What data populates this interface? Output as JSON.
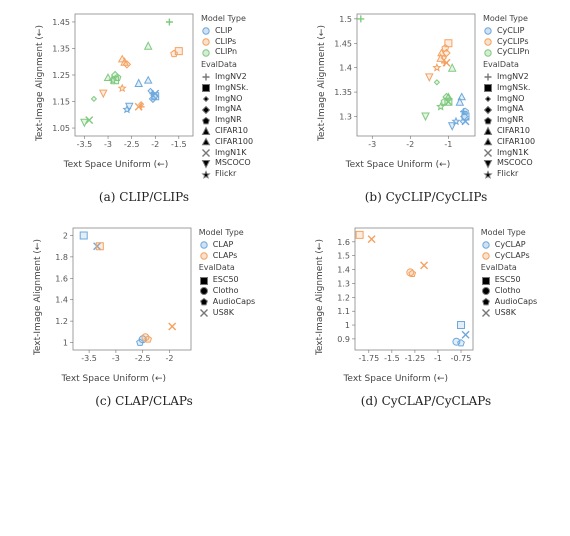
{
  "chart_data": [
    {
      "id": "a",
      "caption": "(a) CLIP/CLIPs",
      "xlabel": "Text Space Uniform (←)",
      "ylabel": "Text-Image Alignment (←)",
      "xlim": [
        -3.7,
        -1.2
      ],
      "ylim": [
        1.02,
        1.48
      ],
      "xticks": [
        -3.5,
        -3.0,
        -2.5,
        -2.0,
        -1.5
      ],
      "yticks": [
        1.05,
        1.15,
        1.25,
        1.35,
        1.45
      ],
      "model_types": [
        {
          "name": "CLIP",
          "color": "#6fa8dc"
        },
        {
          "name": "CLIPs",
          "color": "#f4a261"
        },
        {
          "name": "CLIPn",
          "color": "#7fc97f"
        }
      ],
      "eval_data": [
        "ImgNV2",
        "ImgNSk.",
        "ImgNO",
        "ImgNA",
        "ImgNR",
        "CIFAR10",
        "CIFAR100",
        "ImgN1K",
        "MSCOCO",
        "Flickr"
      ],
      "points": [
        {
          "x": -2.05,
          "y": 1.18,
          "model": "CLIP",
          "dataset": "ImgNV2"
        },
        {
          "x": -2.0,
          "y": 1.17,
          "model": "CLIP",
          "dataset": "ImgNSk."
        },
        {
          "x": -2.1,
          "y": 1.19,
          "model": "CLIP",
          "dataset": "ImgNO"
        },
        {
          "x": -2.05,
          "y": 1.16,
          "model": "CLIP",
          "dataset": "ImgNA"
        },
        {
          "x": -2.02,
          "y": 1.17,
          "model": "CLIP",
          "dataset": "ImgNR"
        },
        {
          "x": -2.35,
          "y": 1.22,
          "model": "CLIP",
          "dataset": "CIFAR10"
        },
        {
          "x": -2.15,
          "y": 1.23,
          "model": "CLIP",
          "dataset": "CIFAR100"
        },
        {
          "x": -2.0,
          "y": 1.18,
          "model": "CLIP",
          "dataset": "ImgN1K"
        },
        {
          "x": -2.55,
          "y": 1.13,
          "model": "CLIP",
          "dataset": "MSCOCO"
        },
        {
          "x": -2.6,
          "y": 1.12,
          "model": "CLIP",
          "dataset": "Flickr"
        },
        {
          "x": -2.3,
          "y": 1.13,
          "model": "CLIPs",
          "dataset": "ImgNV2"
        },
        {
          "x": -1.5,
          "y": 1.34,
          "model": "CLIPs",
          "dataset": "ImgNSk."
        },
        {
          "x": -2.3,
          "y": 1.14,
          "model": "CLIPs",
          "dataset": "ImgNO"
        },
        {
          "x": -2.6,
          "y": 1.29,
          "model": "CLIPs",
          "dataset": "ImgNA"
        },
        {
          "x": -1.6,
          "y": 1.33,
          "model": "CLIPs",
          "dataset": "ImgNR"
        },
        {
          "x": -2.65,
          "y": 1.3,
          "model": "CLIPs",
          "dataset": "CIFAR10"
        },
        {
          "x": -2.7,
          "y": 1.31,
          "model": "CLIPs",
          "dataset": "CIFAR100"
        },
        {
          "x": -2.35,
          "y": 1.13,
          "model": "CLIPs",
          "dataset": "ImgN1K"
        },
        {
          "x": -3.1,
          "y": 1.18,
          "model": "CLIPs",
          "dataset": "MSCOCO"
        },
        {
          "x": -2.7,
          "y": 1.2,
          "model": "CLIPs",
          "dataset": "Flickr"
        },
        {
          "x": -1.7,
          "y": 1.45,
          "model": "CLIPn",
          "dataset": "ImgNV2"
        },
        {
          "x": -2.85,
          "y": 1.23,
          "model": "CLIPn",
          "dataset": "ImgNSk."
        },
        {
          "x": -3.3,
          "y": 1.16,
          "model": "CLIPn",
          "dataset": "ImgNO"
        },
        {
          "x": -2.85,
          "y": 1.25,
          "model": "CLIPn",
          "dataset": "ImgNA"
        },
        {
          "x": -2.8,
          "y": 1.24,
          "model": "CLIPn",
          "dataset": "ImgNR"
        },
        {
          "x": -2.15,
          "y": 1.36,
          "model": "CLIPn",
          "dataset": "CIFAR10"
        },
        {
          "x": -3.0,
          "y": 1.24,
          "model": "CLIPn",
          "dataset": "CIFAR100"
        },
        {
          "x": -3.4,
          "y": 1.08,
          "model": "CLIPn",
          "dataset": "ImgN1K"
        },
        {
          "x": -3.5,
          "y": 1.07,
          "model": "CLIPn",
          "dataset": "MSCOCO"
        },
        {
          "x": -2.9,
          "y": 1.23,
          "model": "CLIPn",
          "dataset": "Flickr"
        }
      ]
    },
    {
      "id": "b",
      "caption": "(b) CyCLIP/CyCLIPs",
      "xlabel": "Text Space Uniform (←)",
      "ylabel": "Text-Image Alignment (←)",
      "xlim": [
        -3.4,
        -0.3
      ],
      "ylim": [
        1.26,
        1.51
      ],
      "xticks": [
        -3,
        -2,
        -1
      ],
      "yticks": [
        1.3,
        1.35,
        1.4,
        1.45,
        1.5
      ],
      "model_types": [
        {
          "name": "CyCLIP",
          "color": "#6fa8dc"
        },
        {
          "name": "CyCLIPs",
          "color": "#f4a261"
        },
        {
          "name": "CyCLIPn",
          "color": "#7fc97f"
        }
      ],
      "eval_data": [
        "ImgNV2",
        "ImgNSk.",
        "ImgNO",
        "ImgNA",
        "ImgNR",
        "CIFAR10",
        "CIFAR100",
        "ImgN1K",
        "MSCOCO",
        "Flickr"
      ],
      "points": [
        {
          "x": -0.6,
          "y": 1.31,
          "model": "CyCLIP",
          "dataset": "ImgNV2"
        },
        {
          "x": -0.55,
          "y": 1.3,
          "model": "CyCLIP",
          "dataset": "ImgNSk."
        },
        {
          "x": -0.62,
          "y": 1.29,
          "model": "CyCLIP",
          "dataset": "ImgNO"
        },
        {
          "x": -0.58,
          "y": 1.3,
          "model": "CyCLIP",
          "dataset": "ImgNA"
        },
        {
          "x": -0.56,
          "y": 1.31,
          "model": "CyCLIP",
          "dataset": "ImgNR"
        },
        {
          "x": -0.7,
          "y": 1.33,
          "model": "CyCLIP",
          "dataset": "CIFAR10"
        },
        {
          "x": -0.65,
          "y": 1.34,
          "model": "CyCLIP",
          "dataset": "CIFAR100"
        },
        {
          "x": -0.55,
          "y": 1.29,
          "model": "CyCLIP",
          "dataset": "ImgN1K"
        },
        {
          "x": -0.9,
          "y": 1.28,
          "model": "CyCLIP",
          "dataset": "MSCOCO"
        },
        {
          "x": -0.8,
          "y": 1.29,
          "model": "CyCLIP",
          "dataset": "Flickr"
        },
        {
          "x": -1.1,
          "y": 1.41,
          "model": "CyCLIPs",
          "dataset": "ImgNV2"
        },
        {
          "x": -1.0,
          "y": 1.45,
          "model": "CyCLIPs",
          "dataset": "ImgNSk."
        },
        {
          "x": -1.12,
          "y": 1.42,
          "model": "CyCLIPs",
          "dataset": "ImgNO"
        },
        {
          "x": -1.05,
          "y": 1.43,
          "model": "CyCLIPs",
          "dataset": "ImgNA"
        },
        {
          "x": -1.08,
          "y": 1.44,
          "model": "CyCLIPs",
          "dataset": "ImgNR"
        },
        {
          "x": -1.2,
          "y": 1.42,
          "model": "CyCLIPs",
          "dataset": "CIFAR10"
        },
        {
          "x": -1.18,
          "y": 1.43,
          "model": "CyCLIPs",
          "dataset": "CIFAR100"
        },
        {
          "x": -1.05,
          "y": 1.41,
          "model": "CyCLIPs",
          "dataset": "ImgN1K"
        },
        {
          "x": -1.5,
          "y": 1.38,
          "model": "CyCLIPs",
          "dataset": "MSCOCO"
        },
        {
          "x": -1.3,
          "y": 1.4,
          "model": "CyCLIPs",
          "dataset": "Flickr"
        },
        {
          "x": -3.3,
          "y": 1.5,
          "model": "CyCLIPn",
          "dataset": "ImgNV2"
        },
        {
          "x": -1.0,
          "y": 1.33,
          "model": "CyCLIPn",
          "dataset": "ImgNSk."
        },
        {
          "x": -1.3,
          "y": 1.37,
          "model": "CyCLIPn",
          "dataset": "ImgNO"
        },
        {
          "x": -1.05,
          "y": 1.34,
          "model": "CyCLIPn",
          "dataset": "ImgNA"
        },
        {
          "x": -1.1,
          "y": 1.33,
          "model": "CyCLIPn",
          "dataset": "ImgNR"
        },
        {
          "x": -0.9,
          "y": 1.4,
          "model": "CyCLIPn",
          "dataset": "CIFAR10"
        },
        {
          "x": -1.0,
          "y": 1.34,
          "model": "CyCLIPn",
          "dataset": "CIFAR100"
        },
        {
          "x": -1.0,
          "y": 1.33,
          "model": "CyCLIPn",
          "dataset": "ImgN1K"
        },
        {
          "x": -1.6,
          "y": 1.3,
          "model": "CyCLIPn",
          "dataset": "MSCOCO"
        },
        {
          "x": -1.2,
          "y": 1.32,
          "model": "CyCLIPn",
          "dataset": "Flickr"
        }
      ]
    },
    {
      "id": "c",
      "caption": "(c) CLAP/CLAPs",
      "xlabel": "Text Space Uniform (←)",
      "ylabel": "Text-Image Alignment (←)",
      "xlim": [
        -3.8,
        -1.6
      ],
      "ylim": [
        0.93,
        2.07
      ],
      "xticks": [
        -3.5,
        -3.0,
        -2.5,
        -2.0
      ],
      "yticks": [
        1.0,
        1.2,
        1.4,
        1.6,
        1.8,
        2.0
      ],
      "model_types": [
        {
          "name": "CLAP",
          "color": "#6fa8dc"
        },
        {
          "name": "CLAPs",
          "color": "#f4a261"
        }
      ],
      "eval_data": [
        "ESC50",
        "Clotho",
        "AudioCaps",
        "US8K"
      ],
      "points": [
        {
          "x": -3.6,
          "y": 2.0,
          "model": "CLAP",
          "dataset": "ESC50"
        },
        {
          "x": -2.5,
          "y": 1.03,
          "model": "CLAP",
          "dataset": "Clotho"
        },
        {
          "x": -2.55,
          "y": 1.0,
          "model": "CLAP",
          "dataset": "AudioCaps"
        },
        {
          "x": -3.35,
          "y": 1.9,
          "model": "CLAP",
          "dataset": "US8K"
        },
        {
          "x": -3.3,
          "y": 1.9,
          "model": "CLAPs",
          "dataset": "ESC50"
        },
        {
          "x": -2.45,
          "y": 1.05,
          "model": "CLAPs",
          "dataset": "Clotho"
        },
        {
          "x": -2.4,
          "y": 1.03,
          "model": "CLAPs",
          "dataset": "AudioCaps"
        },
        {
          "x": -1.95,
          "y": 1.15,
          "model": "CLAPs",
          "dataset": "US8K"
        }
      ]
    },
    {
      "id": "d",
      "caption": "(d) CyCLAP/CyCLAPs",
      "xlabel": "Text Space Uniform (←)",
      "ylabel": "Text-Image Alignment (←)",
      "xlim": [
        -1.9,
        -0.62
      ],
      "ylim": [
        0.82,
        1.7
      ],
      "xticks": [
        -1.75,
        -1.5,
        -1.25,
        -1.0,
        -0.75
      ],
      "yticks": [
        0.9,
        1.0,
        1.1,
        1.2,
        1.3,
        1.4,
        1.5,
        1.6
      ],
      "model_types": [
        {
          "name": "CyCLAP",
          "color": "#6fa8dc"
        },
        {
          "name": "CyCLAPs",
          "color": "#f4a261"
        }
      ],
      "eval_data": [
        "ESC50",
        "Clotho",
        "AudioCaps",
        "US8K"
      ],
      "points": [
        {
          "x": -0.75,
          "y": 1.0,
          "model": "CyCLAP",
          "dataset": "ESC50"
        },
        {
          "x": -0.8,
          "y": 0.88,
          "model": "CyCLAP",
          "dataset": "Clotho"
        },
        {
          "x": -0.75,
          "y": 0.87,
          "model": "CyCLAP",
          "dataset": "AudioCaps"
        },
        {
          "x": -0.7,
          "y": 0.93,
          "model": "CyCLAP",
          "dataset": "US8K"
        },
        {
          "x": -1.85,
          "y": 1.65,
          "model": "CyCLAPs",
          "dataset": "ESC50"
        },
        {
          "x": -1.3,
          "y": 1.38,
          "model": "CyCLAPs",
          "dataset": "Clotho"
        },
        {
          "x": -1.28,
          "y": 1.37,
          "model": "CyCLAPs",
          "dataset": "AudioCaps"
        },
        {
          "x": -1.72,
          "y": 1.62,
          "model": "CyCLAPs",
          "dataset": "US8K"
        },
        {
          "x": -1.15,
          "y": 1.43,
          "model": "CyCLAPs",
          "dataset": "US8K"
        }
      ]
    }
  ],
  "legend_headers": {
    "model": "Model Type",
    "eval": "EvalData"
  },
  "marker_shapes": {
    "ImgNV2": "plus",
    "ImgNSk.": "square",
    "ImgNO": "diamond-small",
    "ImgNA": "diamond",
    "ImgNR": "pentagon",
    "CIFAR10": "triangle-up",
    "CIFAR100": "triangle-up-alt",
    "ImgN1K": "cross",
    "MSCOCO": "triangle-down",
    "Flickr": "star",
    "ESC50": "square",
    "Clotho": "circle",
    "AudioCaps": "pentagon",
    "US8K": "cross"
  }
}
